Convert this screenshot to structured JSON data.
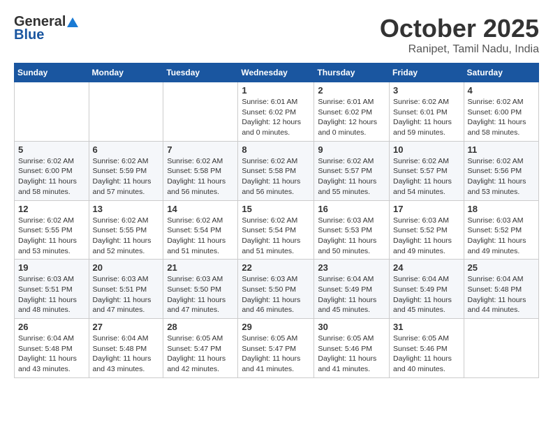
{
  "header": {
    "logo_general": "General",
    "logo_blue": "Blue",
    "month_title": "October 2025",
    "location": "Ranipet, Tamil Nadu, India"
  },
  "days_of_week": [
    "Sunday",
    "Monday",
    "Tuesday",
    "Wednesday",
    "Thursday",
    "Friday",
    "Saturday"
  ],
  "weeks": [
    [
      {
        "day": "",
        "info": ""
      },
      {
        "day": "",
        "info": ""
      },
      {
        "day": "",
        "info": ""
      },
      {
        "day": "1",
        "info": "Sunrise: 6:01 AM\nSunset: 6:02 PM\nDaylight: 12 hours\nand 0 minutes."
      },
      {
        "day": "2",
        "info": "Sunrise: 6:01 AM\nSunset: 6:02 PM\nDaylight: 12 hours\nand 0 minutes."
      },
      {
        "day": "3",
        "info": "Sunrise: 6:02 AM\nSunset: 6:01 PM\nDaylight: 11 hours\nand 59 minutes."
      },
      {
        "day": "4",
        "info": "Sunrise: 6:02 AM\nSunset: 6:00 PM\nDaylight: 11 hours\nand 58 minutes."
      }
    ],
    [
      {
        "day": "5",
        "info": "Sunrise: 6:02 AM\nSunset: 6:00 PM\nDaylight: 11 hours\nand 58 minutes."
      },
      {
        "day": "6",
        "info": "Sunrise: 6:02 AM\nSunset: 5:59 PM\nDaylight: 11 hours\nand 57 minutes."
      },
      {
        "day": "7",
        "info": "Sunrise: 6:02 AM\nSunset: 5:58 PM\nDaylight: 11 hours\nand 56 minutes."
      },
      {
        "day": "8",
        "info": "Sunrise: 6:02 AM\nSunset: 5:58 PM\nDaylight: 11 hours\nand 56 minutes."
      },
      {
        "day": "9",
        "info": "Sunrise: 6:02 AM\nSunset: 5:57 PM\nDaylight: 11 hours\nand 55 minutes."
      },
      {
        "day": "10",
        "info": "Sunrise: 6:02 AM\nSunset: 5:57 PM\nDaylight: 11 hours\nand 54 minutes."
      },
      {
        "day": "11",
        "info": "Sunrise: 6:02 AM\nSunset: 5:56 PM\nDaylight: 11 hours\nand 53 minutes."
      }
    ],
    [
      {
        "day": "12",
        "info": "Sunrise: 6:02 AM\nSunset: 5:55 PM\nDaylight: 11 hours\nand 53 minutes."
      },
      {
        "day": "13",
        "info": "Sunrise: 6:02 AM\nSunset: 5:55 PM\nDaylight: 11 hours\nand 52 minutes."
      },
      {
        "day": "14",
        "info": "Sunrise: 6:02 AM\nSunset: 5:54 PM\nDaylight: 11 hours\nand 51 minutes."
      },
      {
        "day": "15",
        "info": "Sunrise: 6:02 AM\nSunset: 5:54 PM\nDaylight: 11 hours\nand 51 minutes."
      },
      {
        "day": "16",
        "info": "Sunrise: 6:03 AM\nSunset: 5:53 PM\nDaylight: 11 hours\nand 50 minutes."
      },
      {
        "day": "17",
        "info": "Sunrise: 6:03 AM\nSunset: 5:52 PM\nDaylight: 11 hours\nand 49 minutes."
      },
      {
        "day": "18",
        "info": "Sunrise: 6:03 AM\nSunset: 5:52 PM\nDaylight: 11 hours\nand 49 minutes."
      }
    ],
    [
      {
        "day": "19",
        "info": "Sunrise: 6:03 AM\nSunset: 5:51 PM\nDaylight: 11 hours\nand 48 minutes."
      },
      {
        "day": "20",
        "info": "Sunrise: 6:03 AM\nSunset: 5:51 PM\nDaylight: 11 hours\nand 47 minutes."
      },
      {
        "day": "21",
        "info": "Sunrise: 6:03 AM\nSunset: 5:50 PM\nDaylight: 11 hours\nand 47 minutes."
      },
      {
        "day": "22",
        "info": "Sunrise: 6:03 AM\nSunset: 5:50 PM\nDaylight: 11 hours\nand 46 minutes."
      },
      {
        "day": "23",
        "info": "Sunrise: 6:04 AM\nSunset: 5:49 PM\nDaylight: 11 hours\nand 45 minutes."
      },
      {
        "day": "24",
        "info": "Sunrise: 6:04 AM\nSunset: 5:49 PM\nDaylight: 11 hours\nand 45 minutes."
      },
      {
        "day": "25",
        "info": "Sunrise: 6:04 AM\nSunset: 5:48 PM\nDaylight: 11 hours\nand 44 minutes."
      }
    ],
    [
      {
        "day": "26",
        "info": "Sunrise: 6:04 AM\nSunset: 5:48 PM\nDaylight: 11 hours\nand 43 minutes."
      },
      {
        "day": "27",
        "info": "Sunrise: 6:04 AM\nSunset: 5:48 PM\nDaylight: 11 hours\nand 43 minutes."
      },
      {
        "day": "28",
        "info": "Sunrise: 6:05 AM\nSunset: 5:47 PM\nDaylight: 11 hours\nand 42 minutes."
      },
      {
        "day": "29",
        "info": "Sunrise: 6:05 AM\nSunset: 5:47 PM\nDaylight: 11 hours\nand 41 minutes."
      },
      {
        "day": "30",
        "info": "Sunrise: 6:05 AM\nSunset: 5:46 PM\nDaylight: 11 hours\nand 41 minutes."
      },
      {
        "day": "31",
        "info": "Sunrise: 6:05 AM\nSunset: 5:46 PM\nDaylight: 11 hours\nand 40 minutes."
      },
      {
        "day": "",
        "info": ""
      }
    ]
  ]
}
